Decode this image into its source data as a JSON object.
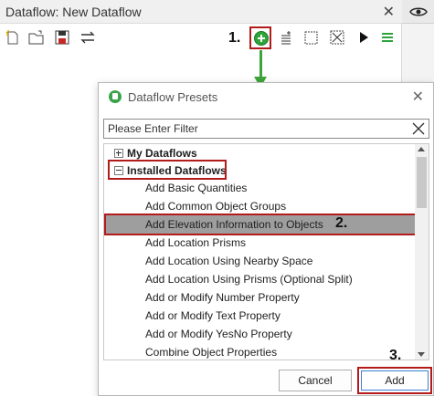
{
  "panel": {
    "title": "Dataflow: New Dataflow",
    "close_glyph": "✕",
    "toolbar_left": [
      "new-file-icon",
      "open-folder-icon",
      "save-icon",
      "swap-icon"
    ],
    "toolbar_right": [
      "add-preset-icon",
      "add-node-list-icon",
      "select-icon",
      "deselect-icon",
      "run-icon",
      "menu-icon"
    ]
  },
  "steps": {
    "one": "1.",
    "two": "2.",
    "three": "3."
  },
  "dialog": {
    "title": "Dataflow Presets",
    "close_glyph": "✕",
    "filter_placeholder": "Please Enter Filter",
    "groups": [
      {
        "label": "My Dataflows",
        "expanded": false
      },
      {
        "label": "Installed Dataflows",
        "expanded": true
      }
    ],
    "items": [
      "Add Basic Quantities",
      "Add Common Object Groups",
      "Add Elevation Information to Objects",
      "Add Location Prisms",
      "Add Location Using Nearby Space",
      "Add Location Using Prisms (Optional Split)",
      "Add or Modify Number Property",
      "Add or Modify Text Property",
      "Add or Modify YesNo Property",
      "Combine Object Properties"
    ],
    "selected_item": "Add Elevation Information to Objects",
    "cancel_label": "Cancel",
    "add_label": "Add"
  },
  "colors": {
    "highlight_red": "#b31b1b",
    "accent_green": "#2ea43a",
    "selection_gray": "#9e9e9e"
  }
}
